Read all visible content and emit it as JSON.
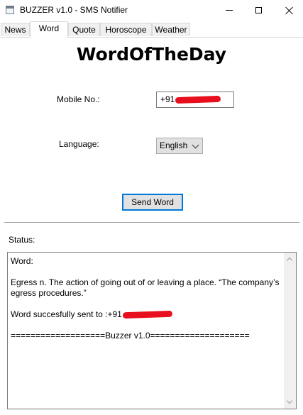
{
  "window": {
    "title": "BUZZER v1.0 - SMS Notifier",
    "icon": "app-window-icon",
    "controls": [
      "minimize-icon",
      "maximize-icon",
      "close-icon"
    ]
  },
  "tabs": [
    {
      "label": "News",
      "active": false
    },
    {
      "label": "Word",
      "active": true
    },
    {
      "label": "Quote",
      "active": false
    },
    {
      "label": "Horoscope",
      "active": false
    },
    {
      "label": "Weather",
      "active": false
    }
  ],
  "main": {
    "title": "WordOfTheDay",
    "mobile_label": "Mobile No.:",
    "mobile_value_prefix": "+91",
    "language_label": "Language:",
    "language_value": "English",
    "send_button": "Send Word",
    "status_label": "Status:"
  },
  "status": {
    "line1": "Word:",
    "line2": "Egress n. The action of going out of or leaving a place. “The company’s egress procedures.”",
    "line3_prefix": "Word succesfully sent to :+91",
    "line4": "===================Buzzer v1.0===================="
  },
  "colors": {
    "accent": "#0078d7",
    "redaction": "#e8101e"
  }
}
